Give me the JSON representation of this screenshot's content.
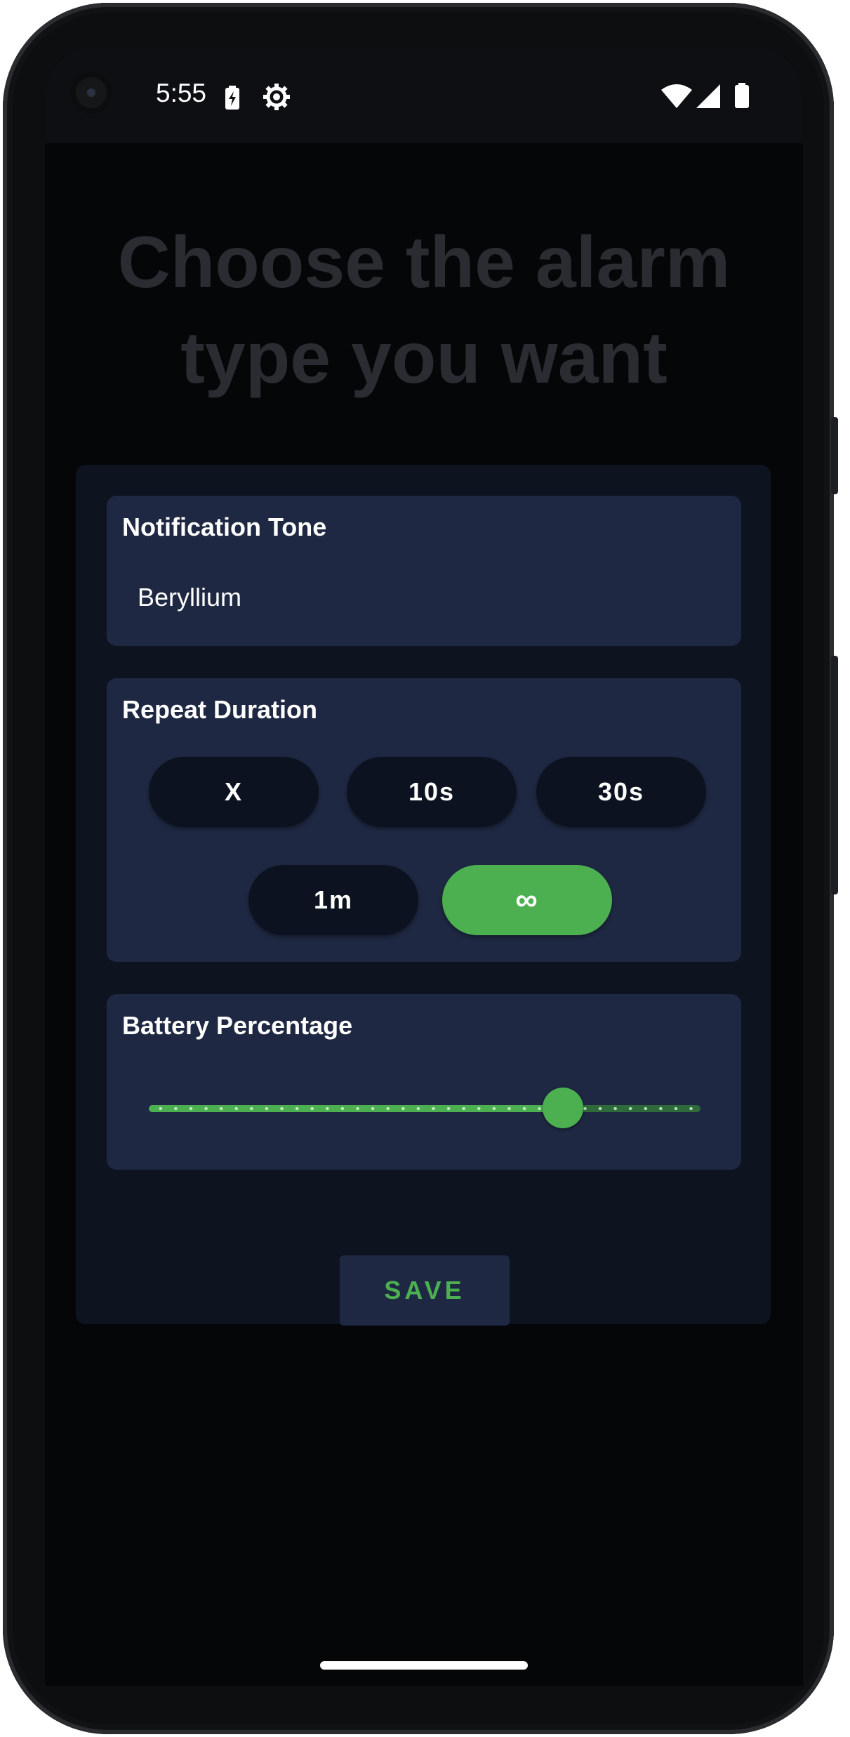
{
  "status_bar": {
    "time": "5:55",
    "icons_left": [
      "battery-charging-icon",
      "settings-gear-icon"
    ],
    "icons_right": [
      "wifi-icon",
      "cellular-signal-icon",
      "battery-icon"
    ]
  },
  "headline": {
    "line1": "Choose the alarm",
    "line2": "type you want"
  },
  "notification_tone": {
    "title": "Notification Tone",
    "value": "Beryllium"
  },
  "repeat_duration": {
    "title": "Repeat Duration",
    "options": [
      "X",
      "10s",
      "30s",
      "1m",
      "∞"
    ],
    "selected": "∞"
  },
  "battery_percentage": {
    "title": "Battery Percentage",
    "value_fraction": 0.75
  },
  "actions": {
    "save_label": "SAVE"
  },
  "colors": {
    "accent": "#4caf50",
    "section_bg": "#1e2842",
    "card_bg": "#0e1320",
    "chip_bg": "#0d1220",
    "headline": "#2a2c31"
  }
}
